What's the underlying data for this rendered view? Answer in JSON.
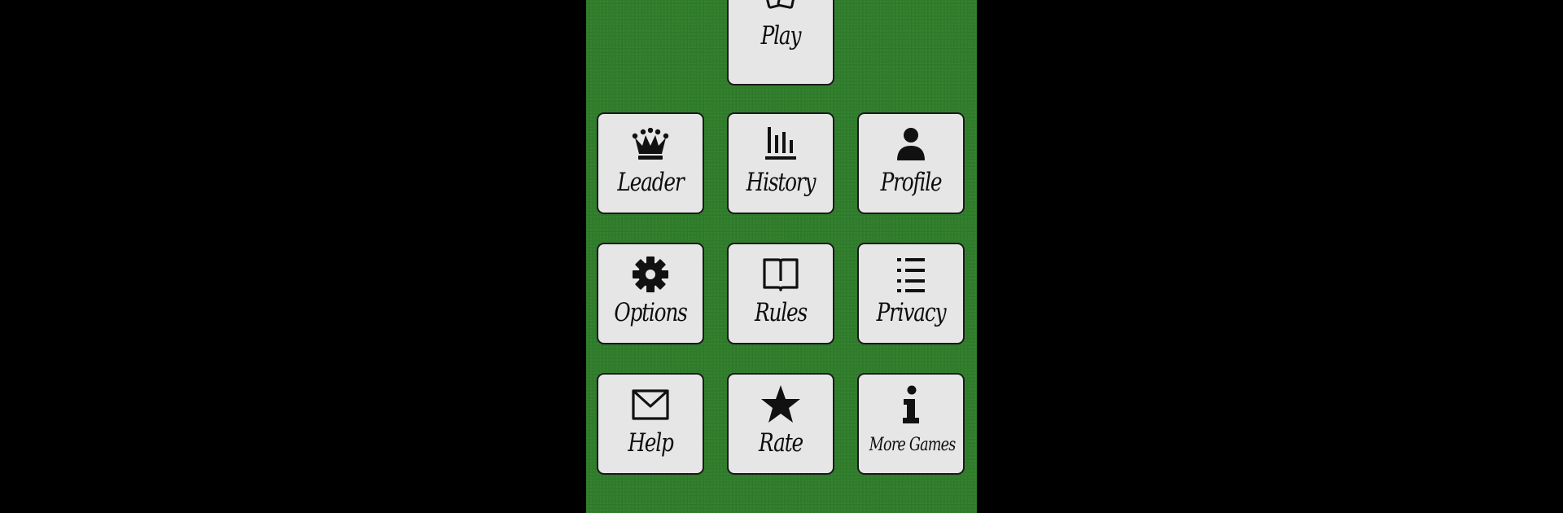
{
  "menu": {
    "play": {
      "label": "Play",
      "icon": "cards-icon"
    },
    "leader": {
      "label": "Leader",
      "icon": "crown-icon"
    },
    "history": {
      "label": "History",
      "icon": "bar-chart-icon"
    },
    "profile": {
      "label": "Profile",
      "icon": "person-icon"
    },
    "options": {
      "label": "Options",
      "icon": "gear-icon"
    },
    "rules": {
      "label": "Rules",
      "icon": "book-icon"
    },
    "privacy": {
      "label": "Privacy",
      "icon": "list-icon"
    },
    "help": {
      "label": "Help",
      "icon": "envelope-icon"
    },
    "rate": {
      "label": "Rate",
      "icon": "star-icon"
    },
    "more_games": {
      "label": "More Games",
      "icon": "info-icon"
    }
  },
  "colors": {
    "letterbox": "#000000",
    "felt": "#2f7d2b",
    "tile": "#e6e6e6",
    "tile_border": "#1a1a1a",
    "ink": "#0d0d0d"
  }
}
